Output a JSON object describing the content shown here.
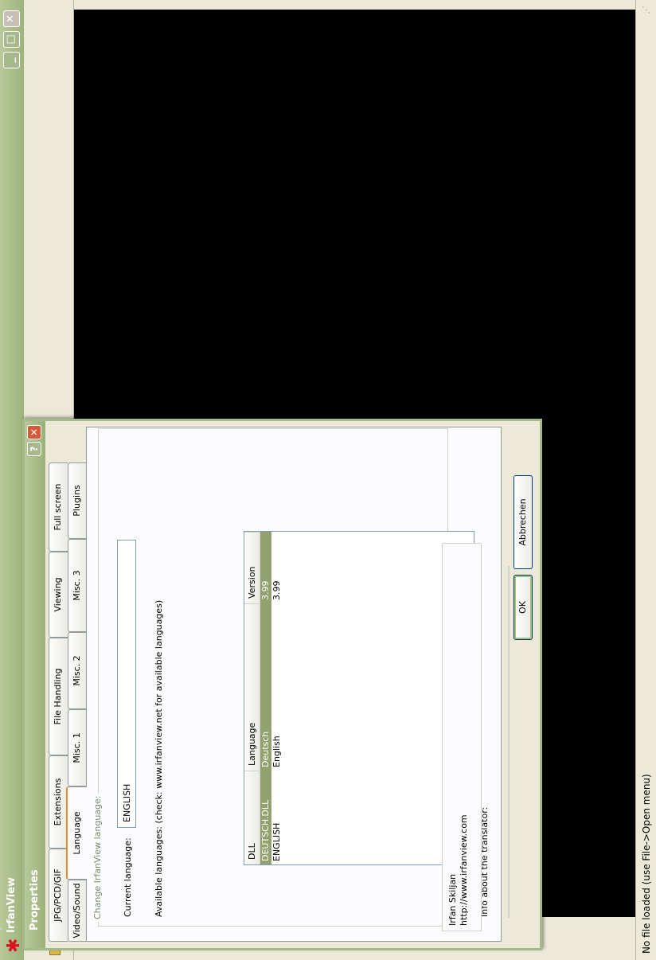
{
  "window": {
    "title": "IrfanView",
    "status": "No file loaded (use File->Open menu)",
    "accent": "#9eb27c",
    "canvas_color": "#000000"
  },
  "dialog": {
    "title": "Properties",
    "tabs_row1": [
      "JPG/PCD/GIF",
      "Extensions",
      "File Handling",
      "Viewing",
      "Full screen"
    ],
    "tabs_row2": [
      "Video/Sound",
      "Language",
      "Misc. 1",
      "Misc. 2",
      "Misc. 3",
      "Plugins"
    ],
    "active_tab": "Language",
    "section_title": "Change IrfanView language:",
    "current_language_label": "Current language:",
    "current_language_value": "ENGLISH",
    "available_label": "Available languages: (check: www.irfanview.net for available languages)",
    "columns": [
      "DLL",
      "Language",
      "Version"
    ],
    "rows": [
      {
        "dll": "DEUTSCH.DLL",
        "language": "Deutsch",
        "version": "3.99",
        "selected": true
      },
      {
        "dll": "ENGLISH",
        "language": "English",
        "version": "3.99",
        "selected": false
      }
    ],
    "translator_label": "Info about the translator:",
    "translator_name": "Irfan Skiljan",
    "translator_url": "http://www.irfanview.com",
    "ok_label": "OK",
    "cancel_label": "Abbrechen",
    "selection_color": "#93a070"
  }
}
